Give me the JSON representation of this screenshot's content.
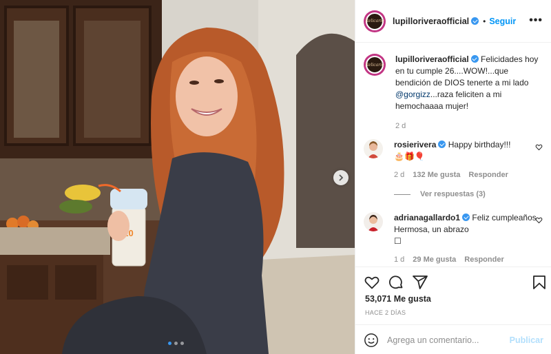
{
  "post": {
    "username": "lupilloriveraofficial",
    "avatar_text": "Relicario",
    "follow_label": "Seguir",
    "more_label": "•••"
  },
  "caption": {
    "username": "lupilloriveraofficial",
    "text_before": " Felicidades hoy en tu cumple 26....WOW!...que bendición de DIOS tenerte a mi lado ",
    "mention": "@gorgizz",
    "text_after": "...raza feliciten a mi hemochaaaa mujer!",
    "time": "2 d"
  },
  "comments": [
    {
      "username": "rosierivera",
      "text": " Happy birthday!!! ",
      "emoji": "🎂🎁🎈",
      "time": "2 d",
      "likes": "132 Me gusta",
      "reply_label": "Responder",
      "view_replies": "Ver respuestas (3)"
    },
    {
      "username": "adrianagallardo1",
      "text": " Feliz cumpleaños Hermosa, un abrazo",
      "emoji": "☐",
      "time": "1 d",
      "likes": "29 Me gusta",
      "reply_label": "Responder"
    }
  ],
  "stats": {
    "likes": "53,071 Me gusta",
    "ago": "HACE 2 DÍAS"
  },
  "composer": {
    "placeholder": "Agrega un comentario...",
    "publish_label": "Publicar"
  },
  "carousel": {
    "total": 3,
    "active": 1
  },
  "colors": {
    "accent": "#0095f6",
    "verified": "#3897f0",
    "muted": "#8e8e8e",
    "publish_disabled": "#b2dffc"
  },
  "icons": [
    "verified-icon",
    "more-options-icon",
    "heart-icon",
    "comment-icon",
    "share-icon",
    "save-icon",
    "emoji-icon",
    "chevron-right-icon"
  ]
}
